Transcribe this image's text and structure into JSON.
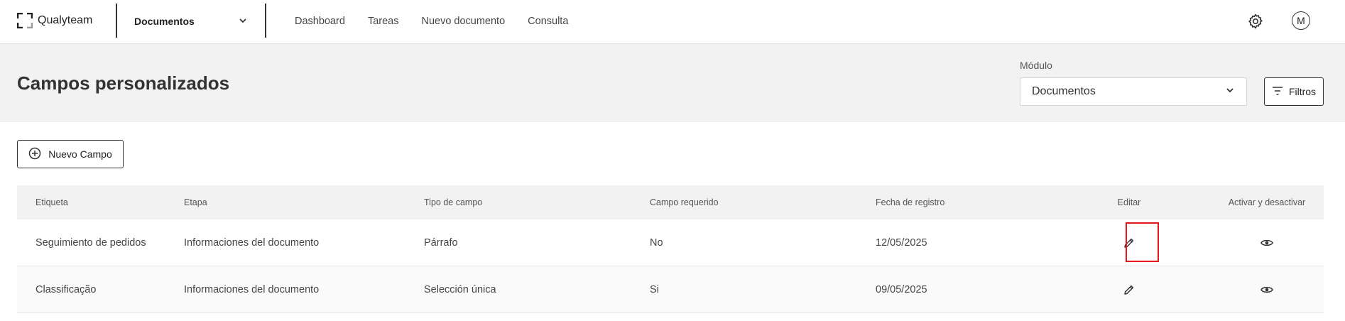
{
  "app": {
    "name": "Qualyteam"
  },
  "topbar": {
    "module_selected": "Documentos",
    "nav": [
      "Dashboard",
      "Tareas",
      "Nuevo documento",
      "Consulta"
    ],
    "avatar_initial": "M"
  },
  "header": {
    "title": "Campos personalizados",
    "module_label": "Módulo",
    "module_value": "Documentos",
    "filter_label": "Filtros"
  },
  "actions": {
    "new_field": "Nuevo Campo"
  },
  "table": {
    "columns": [
      "Etiqueta",
      "Etapa",
      "Tipo de campo",
      "Campo requerido",
      "Fecha de registro",
      "Editar",
      "Activar y desactivar"
    ],
    "rows": [
      {
        "label": "Seguimiento de pedidos",
        "stage": "Informaciones del documento",
        "type": "Párrafo",
        "required": "No",
        "date": "12/05/2025"
      },
      {
        "label": "Classificação",
        "stage": "Informaciones del documento",
        "type": "Selección única",
        "required": "Si",
        "date": "09/05/2025"
      }
    ]
  },
  "colors": {
    "highlight": "#e8151b",
    "band": "#f2f2f2"
  }
}
